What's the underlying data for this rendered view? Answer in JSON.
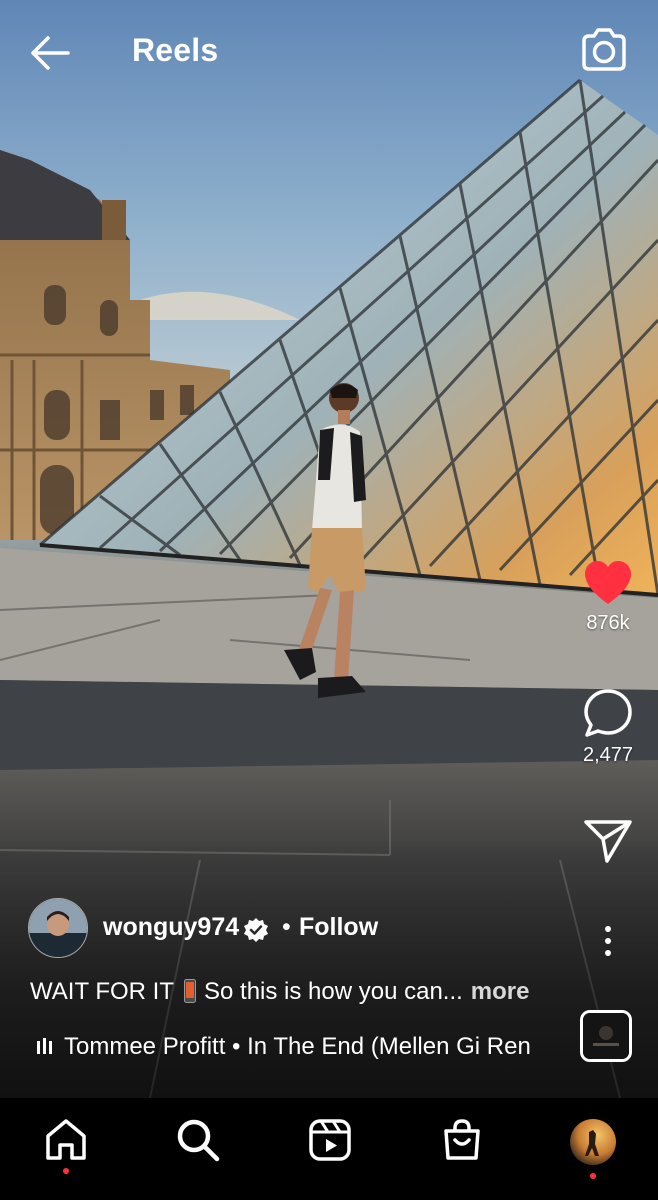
{
  "header": {
    "title": "Reels"
  },
  "reel": {
    "likes": "876k",
    "comments": "2,477",
    "liked": true,
    "accent_like_color": "#ff3040"
  },
  "author": {
    "username": "wonguy974",
    "verified": true,
    "follow_separator": "•",
    "follow_label": "Follow"
  },
  "caption": {
    "text_before": "WAIT FOR IT",
    "text_after": "So this is how you can...",
    "more_label": "more"
  },
  "audio": {
    "label": "Tommee Profitt • In The End (Mellen Gi Ren"
  },
  "icons": {
    "back": "arrow-left-icon",
    "camera": "camera-icon",
    "like": "heart-icon",
    "comment": "comment-bubble-icon",
    "share": "paper-plane-icon",
    "more": "vertical-ellipsis-icon",
    "audio_bars": "audio-bars-icon"
  },
  "nav": {
    "items": [
      "home-icon",
      "search-icon",
      "reels-icon",
      "shop-icon",
      "profile-avatar"
    ],
    "notification_dot_color": "#ff3040"
  }
}
